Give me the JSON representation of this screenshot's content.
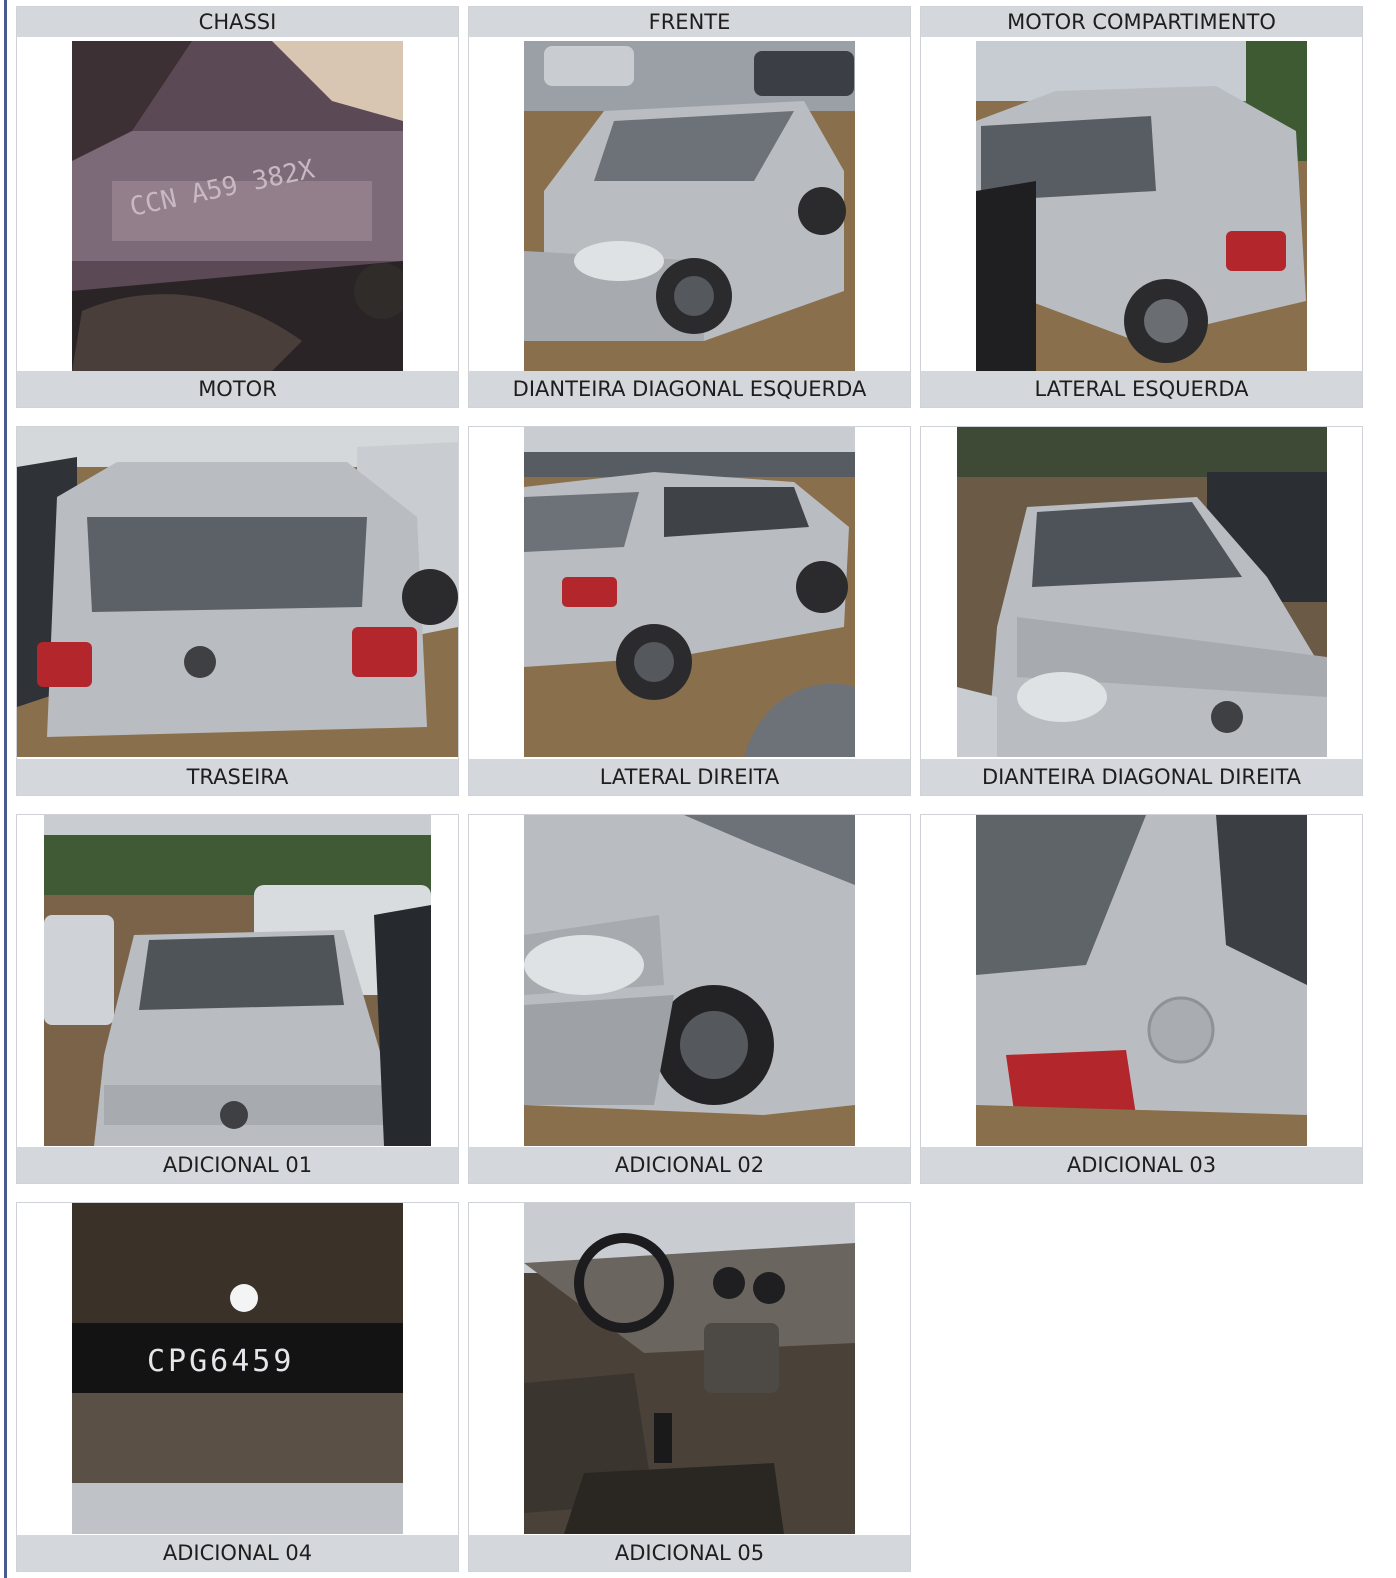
{
  "header_row": [
    {
      "label": "CHASSI"
    },
    {
      "label": "FRENTE"
    },
    {
      "label": "MOTOR COMPARTIMENTO"
    }
  ],
  "photos": [
    {
      "caption": "MOTOR",
      "subject": "engine-stamp",
      "stamp_text": "CCN A59 382X"
    },
    {
      "caption": "DIANTEIRA DIAGONAL ESQUERDA",
      "subject": "car-front-left"
    },
    {
      "caption": "LATERAL ESQUERDA",
      "subject": "car-rear-left"
    },
    {
      "caption": "TRASEIRA",
      "subject": "car-rear"
    },
    {
      "caption": "LATERAL DIREITA",
      "subject": "car-rear-right"
    },
    {
      "caption": "DIANTEIRA DIAGONAL DIREITA",
      "subject": "car-front"
    },
    {
      "caption": "ADICIONAL 01",
      "subject": "car-front"
    },
    {
      "caption": "ADICIONAL 02",
      "subject": "front-fender"
    },
    {
      "caption": "ADICIONAL 03",
      "subject": "rear-quarter"
    },
    {
      "caption": "ADICIONAL 04",
      "subject": "plate-etching",
      "etched_text": "CPG6459"
    },
    {
      "caption": "ADICIONAL 05",
      "subject": "interior-dashboard"
    }
  ],
  "colors": {
    "caption_bg": "#d4d7db",
    "border": "#cfd3d8",
    "left_rule": "#4a5a8c",
    "car_silver": "#b9bcc0",
    "dirt_ground": "#8a6f4c"
  }
}
